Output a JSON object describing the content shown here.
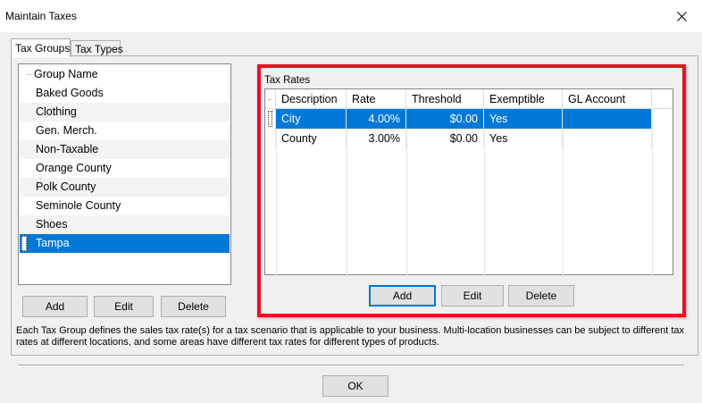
{
  "window": {
    "title": "Maintain Taxes"
  },
  "tabs": [
    {
      "label": "Tax Groups",
      "active": true
    },
    {
      "label": "Tax Types",
      "active": false
    }
  ],
  "group_list": {
    "header": "Group Name",
    "items": [
      "Baked Goods",
      "Clothing",
      "Gen. Merch.",
      "Non-Taxable",
      "Orange County",
      "Polk County",
      "Seminole County",
      "Shoes",
      "Tampa"
    ],
    "selected": "Tampa"
  },
  "group_buttons": {
    "add": "Add",
    "edit": "Edit",
    "delete": "Delete"
  },
  "tax_rates": {
    "label": "Tax Rates",
    "columns": [
      "Description",
      "Rate",
      "Threshold",
      "Exemptible",
      "GL Account"
    ],
    "rows": [
      {
        "description": "City",
        "rate": "4.00%",
        "threshold": "$0.00",
        "exemptible": "Yes",
        "gl_account": ""
      },
      {
        "description": "County",
        "rate": "3.00%",
        "threshold": "$0.00",
        "exemptible": "Yes",
        "gl_account": ""
      }
    ],
    "buttons": {
      "add": "Add",
      "edit": "Edit",
      "delete": "Delete"
    }
  },
  "help_text": "Each Tax Group defines the sales tax rate(s) for a tax scenario that is applicable to your business. Multi-location businesses can be subject to different tax rates at different locations, and some areas have different tax rates for different types of products.",
  "ok_button": "OK",
  "colors": {
    "selection": "#0078d7",
    "highlight_frame": "#e81123"
  }
}
